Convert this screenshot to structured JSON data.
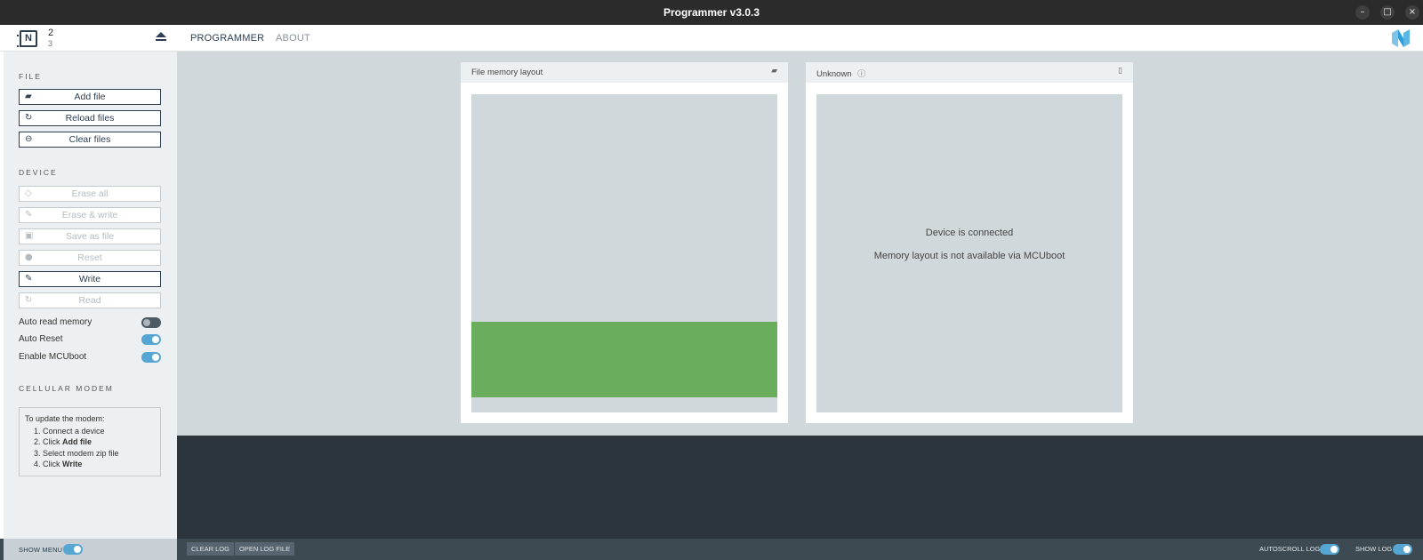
{
  "window": {
    "title": "Programmer v3.0.3"
  },
  "device": {
    "id_top": "2",
    "id_bottom": "3",
    "chip_letter": "N"
  },
  "nav": {
    "tabs": [
      {
        "label": "PROGRAMMER"
      },
      {
        "label": "ABOUT"
      }
    ]
  },
  "sidebar": {
    "file_section": "FILE",
    "file_buttons": [
      {
        "label": "Add file"
      },
      {
        "label": "Reload files"
      },
      {
        "label": "Clear files"
      }
    ],
    "device_section": "DEVICE",
    "device_buttons": [
      {
        "label": "Erase all",
        "enabled": false
      },
      {
        "label": "Erase & write",
        "enabled": false
      },
      {
        "label": "Save as file",
        "enabled": false
      },
      {
        "label": "Reset",
        "enabled": false
      },
      {
        "label": "Write",
        "enabled": true
      },
      {
        "label": "Read",
        "enabled": false
      }
    ],
    "toggles": [
      {
        "label": "Auto read memory",
        "on": false
      },
      {
        "label": "Auto Reset",
        "on": true
      },
      {
        "label": "Enable MCUboot",
        "on": true
      }
    ],
    "modem_section": "CELLULAR MODEM",
    "modem": {
      "intro": "To update the modem:",
      "step1": "Connect a device",
      "step2_prefix": "Click ",
      "step2_bold": "Add file",
      "step3": "Select modem zip file",
      "step4_prefix": "Click ",
      "step4_bold": "Write"
    }
  },
  "file_memory": {
    "title": "File memory layout",
    "region_color": "#6aad5c"
  },
  "device_memory": {
    "title": "Unknown",
    "message1": "Device is connected",
    "message2": "Memory layout is not available via MCUboot"
  },
  "footer": {
    "show_menu": "SHOW MENU",
    "clear_log": "CLEAR LOG",
    "open_log_file": "OPEN LOG FILE",
    "autoscroll_log": "AUTOSCROLL LOG",
    "show_log": "SHOW LOG"
  },
  "colors": {
    "accent": "#55a6d3",
    "brand": "#2c3e50",
    "title_bar": "#2b2b2b"
  }
}
